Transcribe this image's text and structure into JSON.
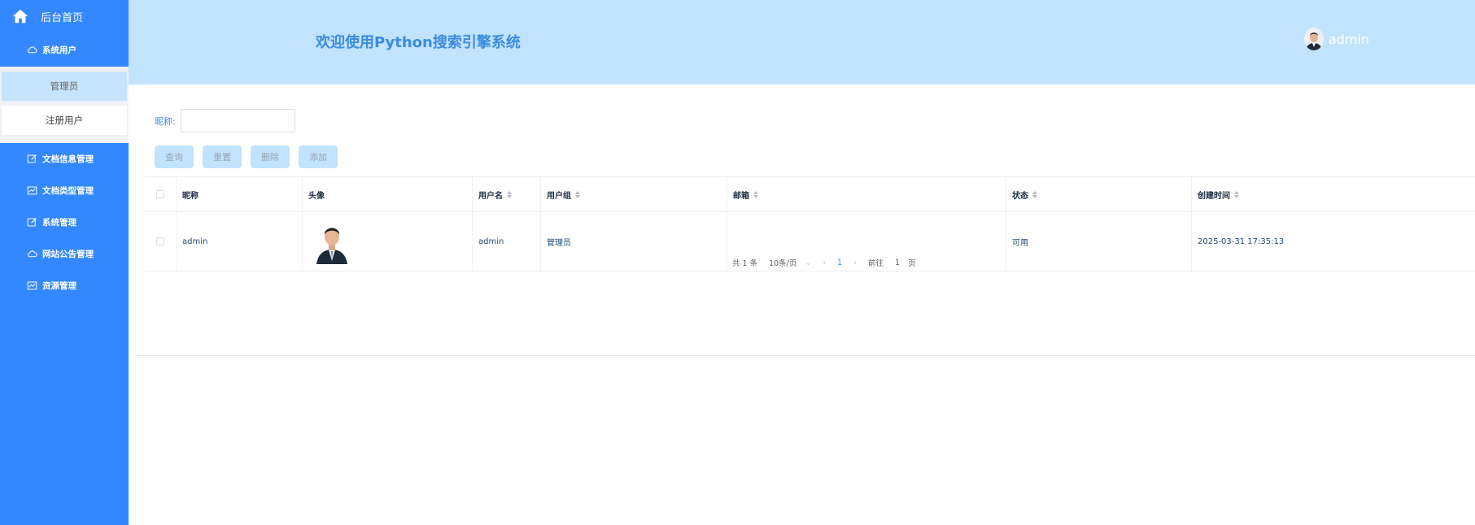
{
  "sidebar": {
    "home_label": "后台首页",
    "menu_system_users": "系统用户",
    "submenu": [
      "管理员",
      "注册用户"
    ],
    "items": [
      {
        "label": "文档信息管理",
        "icon": "edit-icon"
      },
      {
        "label": "文档类型管理",
        "icon": "chart-icon"
      },
      {
        "label": "系统管理",
        "icon": "edit-icon"
      },
      {
        "label": "网站公告管理",
        "icon": "cloud-icon"
      },
      {
        "label": "资源管理",
        "icon": "chart-icon"
      }
    ]
  },
  "header": {
    "title": "欢迎使用Python搜索引擎系统",
    "username": "admin"
  },
  "search": {
    "label": "昵称:",
    "value": ""
  },
  "buttons": {
    "query": "查询",
    "reset": "重置",
    "delete": "删除",
    "add": "添加"
  },
  "table": {
    "headers": [
      "昵称",
      "头像",
      "用户名",
      "用户组",
      "邮箱",
      "状态",
      "创建时间"
    ],
    "rows": [
      {
        "nickname": "admin",
        "username": "admin",
        "group": "管理员",
        "email": "",
        "status": "可用",
        "created": "2025-03-31 17:35:13"
      }
    ]
  },
  "pagination": {
    "total": "共 1 条",
    "page_size": "10条/页",
    "current": "1",
    "goto_label": "前往",
    "goto_value": "1",
    "page_suffix": "页"
  },
  "colors": {
    "sidebar": "#3388ff",
    "header": "#c1e3fd",
    "title": "#3b8ce0",
    "button": "#c1e3fd"
  }
}
